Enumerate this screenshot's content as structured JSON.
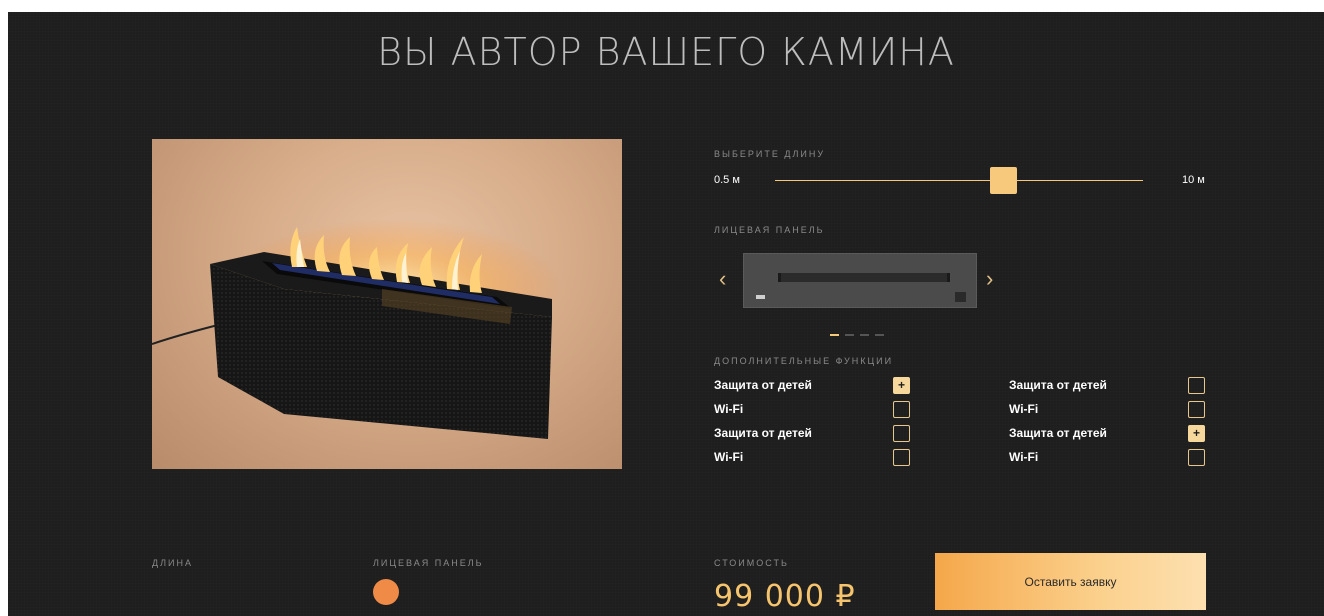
{
  "title": "ВЫ АВТОР ВАШЕГО КАМИНА",
  "length": {
    "label": "ВЫБЕРИТЕ ДЛИНУ",
    "min_label": "0.5 м",
    "max_label": "10 м",
    "slider_fraction": 0.62
  },
  "panel": {
    "label": "ЛИЦЕВАЯ ПАНЕЛЬ",
    "prev_icon": "chevron-left-icon",
    "next_icon": "chevron-right-icon",
    "prev_glyph": "‹",
    "next_glyph": "›",
    "slides_total": 4,
    "active_slide": 1
  },
  "functions": {
    "label": "ДОПОЛНИТЕЛЬНЫЕ ФУНКЦИИ",
    "check_glyph": "+",
    "left": [
      {
        "name": "Защита от детей",
        "checked": true
      },
      {
        "name": "Wi-Fi",
        "checked": false
      },
      {
        "name": "Защита от детей",
        "checked": false
      },
      {
        "name": "Wi-Fi",
        "checked": false
      }
    ],
    "right": [
      {
        "name": "Защита от детей",
        "checked": false
      },
      {
        "name": "Wi-Fi",
        "checked": false
      },
      {
        "name": "Защита от детей",
        "checked": true
      },
      {
        "name": "Wi-Fi",
        "checked": false
      }
    ]
  },
  "summary": {
    "length_label": "ДЛИНА",
    "panel_label": "ЛИЦЕВАЯ ПАНЕЛЬ",
    "panel_color": "#f08a47",
    "cost_label": "СТОИМОСТЬ",
    "price": "99 000 ₽",
    "cta_label": "Оставить заявку"
  },
  "colors": {
    "accent": "#f5c77a",
    "background": "#1e1e1e"
  }
}
